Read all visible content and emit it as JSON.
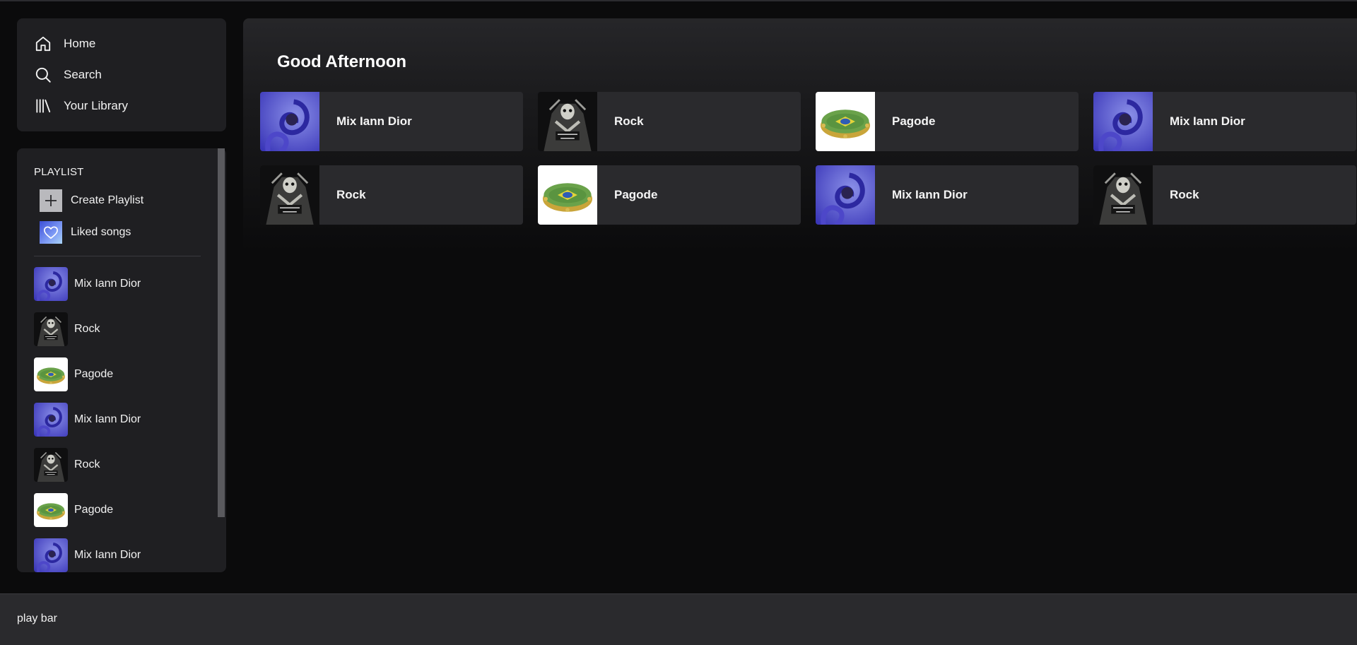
{
  "nav": {
    "items": [
      {
        "label": "Home",
        "icon": "home-icon"
      },
      {
        "label": "Search",
        "icon": "search-icon"
      },
      {
        "label": "Your Library",
        "icon": "library-icon"
      }
    ]
  },
  "library": {
    "heading": "PLAYLIST",
    "create_label": "Create Playlist",
    "liked_label": "Liked songs",
    "playlists": [
      {
        "label": "Mix Iann Dior",
        "cover": "purple-swirl"
      },
      {
        "label": "Rock",
        "cover": "skeleton"
      },
      {
        "label": "Pagode",
        "cover": "tambourine"
      },
      {
        "label": "Mix Iann Dior",
        "cover": "purple-swirl"
      },
      {
        "label": "Rock",
        "cover": "skeleton"
      },
      {
        "label": "Pagode",
        "cover": "tambourine"
      },
      {
        "label": "Mix Iann Dior",
        "cover": "purple-swirl"
      }
    ]
  },
  "main": {
    "greeting": "Good Afternoon",
    "cards": [
      {
        "label": "Mix Iann Dior",
        "cover": "purple-swirl"
      },
      {
        "label": "Rock",
        "cover": "skeleton"
      },
      {
        "label": "Pagode",
        "cover": "tambourine"
      },
      {
        "label": "Mix Iann Dior",
        "cover": "purple-swirl"
      },
      {
        "label": "Rock",
        "cover": "skeleton"
      },
      {
        "label": "Pagode",
        "cover": "tambourine"
      },
      {
        "label": "Mix Iann Dior",
        "cover": "purple-swirl"
      },
      {
        "label": "Rock",
        "cover": "skeleton"
      }
    ]
  },
  "playbar": {
    "label": "play bar"
  },
  "colors": {
    "background": "#0b0b0c",
    "panel": "#1f1f22",
    "card": "#2a2a2d"
  }
}
